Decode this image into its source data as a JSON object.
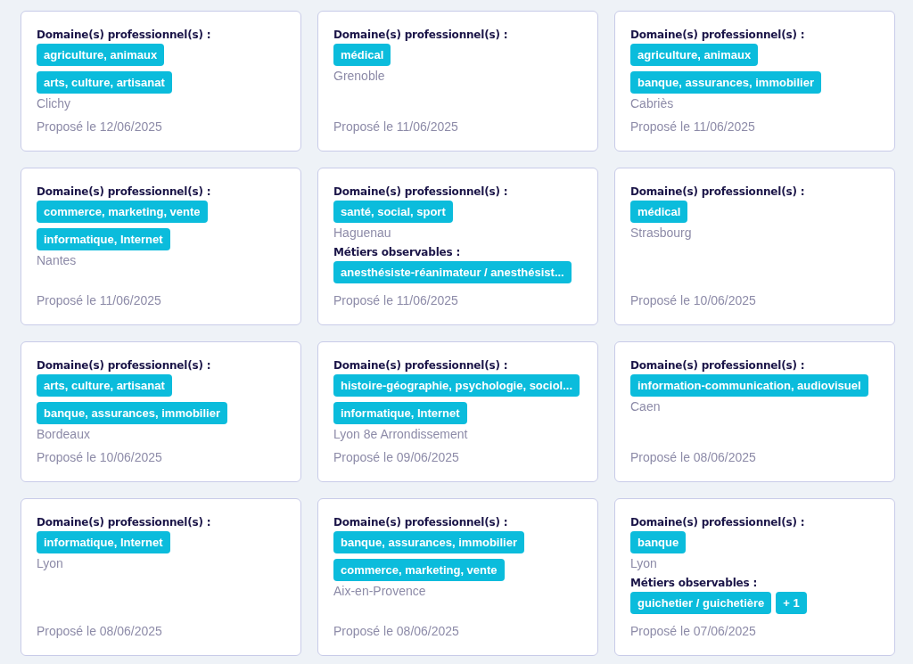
{
  "cards": [
    {
      "domains_label": "Domaine(s) professionnel(s) :",
      "domains": [
        "agriculture, animaux",
        "arts, culture, artisanat"
      ],
      "location": "Clichy",
      "date": "Proposé le 12/06/2025"
    },
    {
      "domains_label": "Domaine(s) professionnel(s) :",
      "domains": [
        "médical"
      ],
      "location": "Grenoble",
      "date": "Proposé le 11/06/2025"
    },
    {
      "domains_label": "Domaine(s) professionnel(s) :",
      "domains": [
        "agriculture, animaux",
        "banque, assurances, immobilier"
      ],
      "location": "Cabriès",
      "date": "Proposé le 11/06/2025"
    },
    {
      "domains_label": "Domaine(s) professionnel(s) :",
      "domains": [
        "commerce, marketing, vente",
        "informatique, Internet"
      ],
      "location": "Nantes",
      "date": "Proposé le 11/06/2025"
    },
    {
      "domains_label": "Domaine(s) professionnel(s) :",
      "domains": [
        "santé, social, sport"
      ],
      "location": "Haguenau",
      "jobs_label": "Métiers observables :",
      "jobs": [
        "anesthésiste-réanimateur / anesthésist..."
      ],
      "date": "Proposé le 11/06/2025"
    },
    {
      "domains_label": "Domaine(s) professionnel(s) :",
      "domains": [
        "médical"
      ],
      "location": "Strasbourg",
      "date": "Proposé le 10/06/2025"
    },
    {
      "domains_label": "Domaine(s) professionnel(s) :",
      "domains": [
        "arts, culture, artisanat",
        "banque, assurances, immobilier"
      ],
      "location": "Bordeaux",
      "date": "Proposé le 10/06/2025"
    },
    {
      "domains_label": "Domaine(s) professionnel(s) :",
      "domains": [
        "histoire-géographie, psychologie, sociol...",
        "informatique, Internet"
      ],
      "location": "Lyon 8e Arrondissement",
      "date": "Proposé le 09/06/2025"
    },
    {
      "domains_label": "Domaine(s) professionnel(s) :",
      "domains": [
        "information-communication, audiovisuel"
      ],
      "location": "Caen",
      "date": "Proposé le 08/06/2025"
    },
    {
      "domains_label": "Domaine(s) professionnel(s) :",
      "domains": [
        "informatique, Internet"
      ],
      "location": "Lyon",
      "date": "Proposé le 08/06/2025"
    },
    {
      "domains_label": "Domaine(s) professionnel(s) :",
      "domains": [
        "banque, assurances, immobilier",
        "commerce, marketing, vente"
      ],
      "location": "Aix-en-Provence",
      "date": "Proposé le 08/06/2025"
    },
    {
      "domains_label": "Domaine(s) professionnel(s) :",
      "domains": [
        "banque"
      ],
      "location": "Lyon",
      "jobs_label": "Métiers observables :",
      "jobs": [
        "guichetier / guichetière"
      ],
      "more": "+ 1",
      "date": "Proposé le 07/06/2025"
    }
  ]
}
